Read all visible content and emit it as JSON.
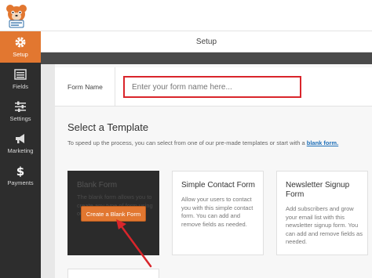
{
  "sidebar": {
    "items": [
      {
        "label": "Setup",
        "icon": "gear-icon",
        "active": true
      },
      {
        "label": "Fields",
        "icon": "fields-list-icon",
        "active": false
      },
      {
        "label": "Settings",
        "icon": "sliders-icon",
        "active": false
      },
      {
        "label": "Marketing",
        "icon": "megaphone-icon",
        "active": false
      },
      {
        "label": "Payments",
        "icon": "dollar-icon",
        "active": false
      }
    ]
  },
  "header": {
    "logo_icon": "wpforms-bear-logo",
    "title": "Setup"
  },
  "form_name": {
    "label": "Form Name",
    "placeholder": "Enter your form name here...",
    "value": ""
  },
  "templates": {
    "title": "Select a Template",
    "description_prefix": "To speed up the process, you can select from one of our pre-made templates or start with a",
    "description_link": "blank form.",
    "cards": {
      "blank": {
        "title": "Blank Form",
        "description": "The blank form allows you to create any type of form using our drag & drop builder.",
        "button": "Create a Blank Form"
      },
      "contact": {
        "title": "Simple Contact Form",
        "description": "Allow your users to contact you with this simple contact form. You can add and remove fields as needed."
      },
      "newsletter": {
        "title": "Newsletter Signup Form",
        "description": "Add subscribers and grow your email list with this newsletter signup form. You can add and remove fields as needed."
      }
    }
  },
  "colors": {
    "accent": "#e27730",
    "sidebar_bg": "#2d2d2d",
    "highlight": "#d9252b",
    "link": "#1e6fb8"
  }
}
